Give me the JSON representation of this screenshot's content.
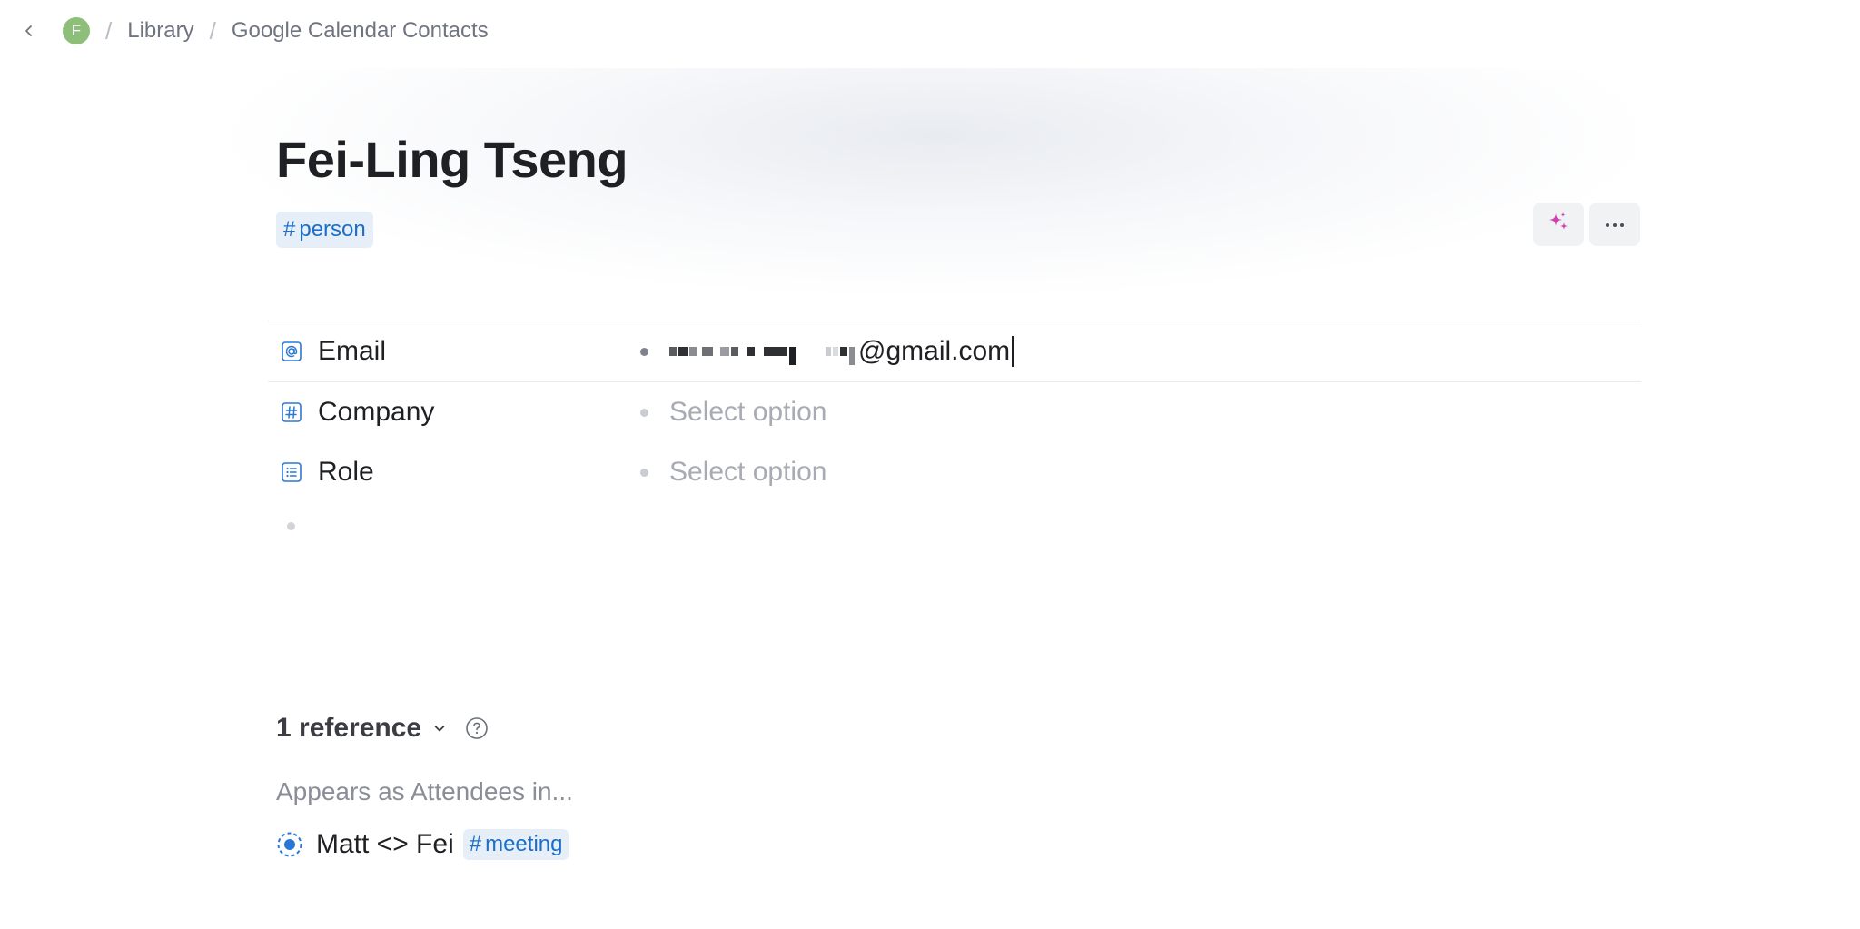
{
  "breadcrumb": {
    "avatar_letter": "F",
    "items": [
      "Library",
      "Google Calendar Contacts"
    ],
    "separator": "/"
  },
  "page": {
    "title": "Fei-Ling Tseng",
    "tag": "person",
    "tag_prefix": "#"
  },
  "toolbar": {
    "ai_icon": "sparkles-icon",
    "more_icon": "more-horizontal-icon",
    "accent_color": "#d23fb4"
  },
  "fields": [
    {
      "label": "Email",
      "icon": "at-sign-icon",
      "value": "@gmail.com",
      "redacted": true
    },
    {
      "label": "Company",
      "icon": "hash-icon",
      "placeholder": "Select option"
    },
    {
      "label": "Role",
      "icon": "list-icon",
      "placeholder": "Select option"
    }
  ],
  "references": {
    "count_label": "1 reference",
    "appears_label": "Appears as Attendees in...",
    "items": [
      {
        "title": "Matt <> Fei",
        "tag": "meeting",
        "tag_prefix": "#",
        "icon": "meeting-status-icon"
      }
    ]
  },
  "colors": {
    "tag_bg": "#e6eef8",
    "tag_text": "#1c6ec9",
    "avatar_bg": "#8dbf7b"
  }
}
